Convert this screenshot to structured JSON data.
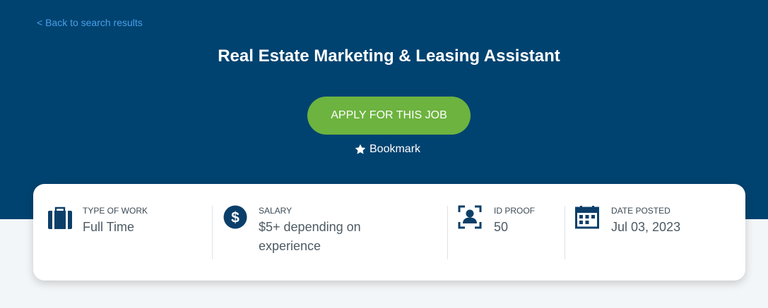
{
  "header": {
    "back_link": "< Back to search results",
    "job_title": "Real Estate Marketing & Leasing Assistant",
    "apply_label": "APPLY FOR THIS JOB",
    "bookmark_label": "Bookmark"
  },
  "details": [
    {
      "label": "TYPE OF WORK",
      "value": "Full Time",
      "icon": "briefcase-icon"
    },
    {
      "label": "SALARY",
      "value": "$5+ depending on experience",
      "icon": "dollar-icon"
    },
    {
      "label": "ID PROOF",
      "value": "50",
      "icon": "id-proof-icon"
    },
    {
      "label": "DATE POSTED",
      "value": "Jul 03, 2023",
      "icon": "calendar-icon"
    }
  ],
  "colors": {
    "hero_bg": "#004370",
    "apply_button": "#6db33f",
    "link": "#4a9eea",
    "icon": "#0b3f69"
  }
}
